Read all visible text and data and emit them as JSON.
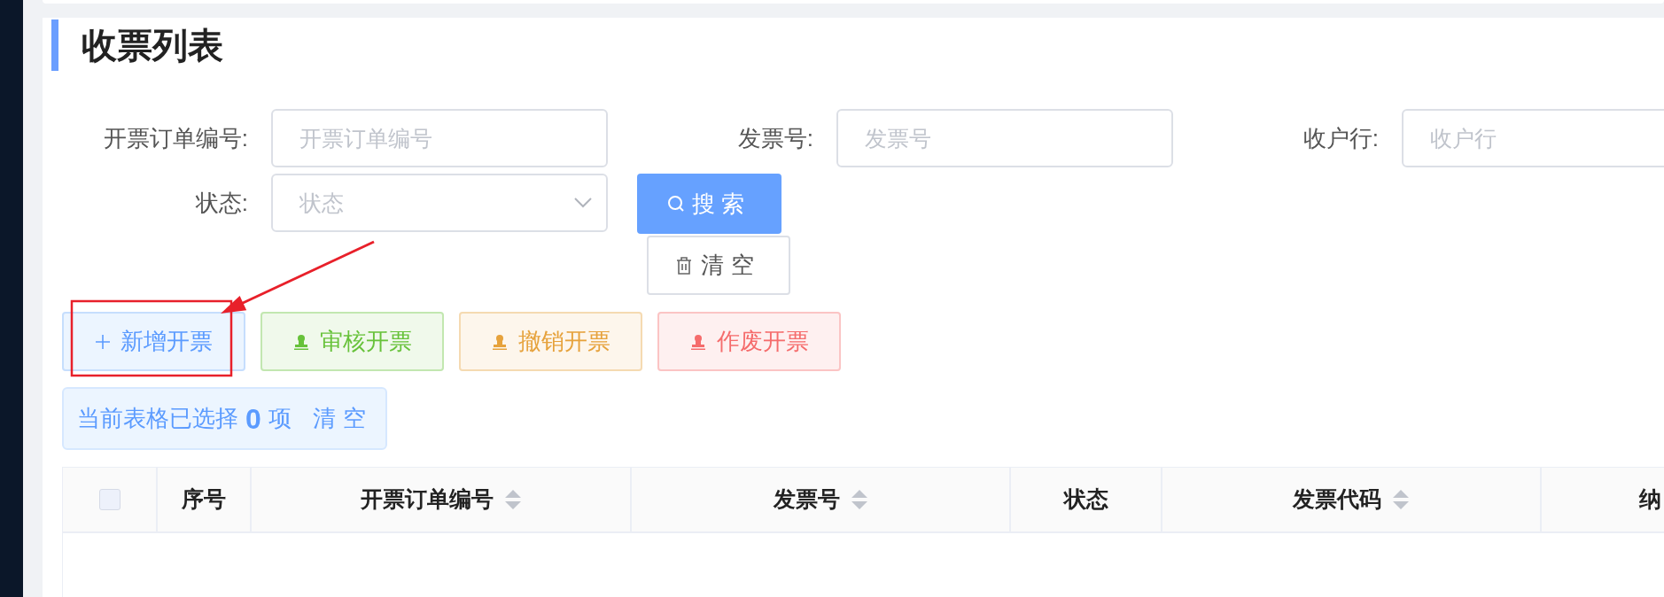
{
  "page_title": "收票列表",
  "filters": [
    {
      "kind": "input",
      "label": "开票订单编号:",
      "placeholder": "开票订单编号"
    },
    {
      "kind": "input",
      "label": "发票号:",
      "placeholder": "发票号"
    },
    {
      "kind": "input",
      "label": "收户行:",
      "placeholder": "收户行"
    },
    {
      "kind": "select",
      "label": "状态:",
      "placeholder": "状态"
    }
  ],
  "search_button": {
    "label": "搜索"
  },
  "clear_button": {
    "label": "清空"
  },
  "actions": [
    {
      "kind": "plus",
      "label": "新增开票",
      "color": "#5b9bff"
    },
    {
      "kind": "stamp",
      "label": "审核开票",
      "color": "#67c23a"
    },
    {
      "kind": "stamp",
      "label": "撤销开票",
      "color": "#e6a23c"
    },
    {
      "kind": "stamp",
      "label": "作废开票",
      "color": "#f56c6c"
    }
  ],
  "selection_bar": {
    "prefix": "当前表格已选择",
    "count": "0",
    "suffix": "项",
    "clear_link": "清空"
  },
  "table": {
    "columns": [
      {
        "kind": "selection",
        "checked": false
      },
      {
        "kind": "text",
        "label": "序号",
        "sortable": false
      },
      {
        "kind": "text",
        "label": "开票订单编号",
        "sortable": true
      },
      {
        "kind": "text",
        "label": "发票号",
        "sortable": true
      },
      {
        "kind": "text",
        "label": "状态",
        "sortable": false
      },
      {
        "kind": "text",
        "label": "发票代码",
        "sortable": true
      },
      {
        "kind": "text",
        "label": "纳",
        "sortable": false
      }
    ]
  }
}
